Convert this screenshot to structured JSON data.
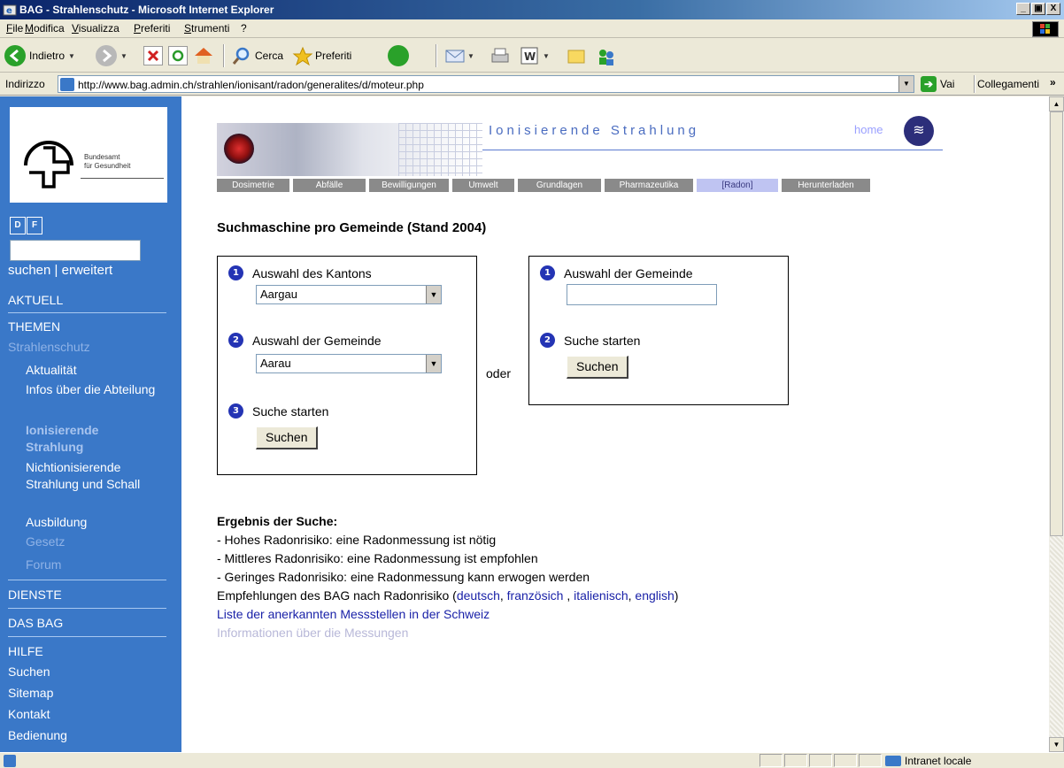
{
  "window": {
    "title": "BAG - Strahlenschutz - Microsoft Internet Explorer",
    "caption_buttons": [
      "_",
      " ",
      "X"
    ]
  },
  "menu": [
    "File",
    "Modifica",
    "Visualizza",
    "Preferiti",
    "Strumenti",
    "?"
  ],
  "toolbar": {
    "back_label": "Indietro",
    "search_label": "Cerca",
    "favorites_label": "Preferiti"
  },
  "address": {
    "label": "Indirizzo",
    "url": "http://www.bag.admin.ch/strahlen/ionisant/radon/generalites/d/moteur.php",
    "go_label": "Vai",
    "links_label": "Collegamenti"
  },
  "sidebar": {
    "logo_text_line1": "Bundesamt",
    "logo_text_line2": "für Gesundheit",
    "lang_d": "D",
    "lang_f": "F",
    "search_links": "suchen | erweitert",
    "items": [
      {
        "label": "AKTUELL"
      },
      {
        "label": "THEMEN"
      },
      {
        "label": "Strahlenschutz"
      },
      {
        "label": "Aktualität"
      },
      {
        "label": "Infos über die Abteilung"
      },
      {
        "label": "Ionisierende Strahlung"
      },
      {
        "label": "Nichtionisierende Strahlung und Schall"
      },
      {
        "label": "Ausbildung"
      },
      {
        "label": "Gesetz"
      },
      {
        "label": "Forum"
      },
      {
        "label": "DIENSTE"
      },
      {
        "label": "DAS BAG"
      },
      {
        "label": "HILFE"
      },
      {
        "label": "Suchen"
      },
      {
        "label": "Sitemap"
      },
      {
        "label": "Kontakt"
      },
      {
        "label": "Bedienung"
      }
    ]
  },
  "banner": {
    "title": "Ionisierende Strahlung",
    "home_label": "home"
  },
  "navtabs": [
    "Dosimetrie",
    "Abfälle",
    "Bewilligungen",
    "Umwelt",
    "Grundlagen",
    "Pharmazeutika",
    "[Radon]",
    "Herunterladen"
  ],
  "content": {
    "page_title": "Suchmaschine pro Gemeinde (Stand 2004)",
    "left_panel": {
      "step1_num": "1",
      "step1_label": "Auswahl des Kantons",
      "canton_value": "Aargau",
      "step2_num": "2",
      "step2_label": "Auswahl der Gemeinde",
      "gemeinde_value": "Aarau",
      "step3_num": "3",
      "step3_label": "Suche starten",
      "button_label": "Suchen"
    },
    "oder": "oder",
    "right_panel": {
      "step1_num": "1",
      "step1_label": "Auswahl der Gemeinde",
      "input_value": "",
      "step2_num": "2",
      "step2_label": "Suche starten",
      "button_label": "Suchen"
    },
    "results": {
      "heading": "Ergebnis der Suche:",
      "lines": [
        "- Hohes Radonrisiko: eine Radonmessung ist nötig",
        "- Mittleres Radonrisiko: eine Radonmessung ist empfohlen",
        "- Geringes Radonrisiko: eine Radonmessung kann erwogen werden"
      ],
      "recommend_prefix": "Empfehlungen des BAG nach Radonrisiko (",
      "link_de": "deutsch",
      "link_fr": "französich",
      "link_it": "italienisch",
      "link_en": "english",
      "sep1": ", ",
      "sep2": " , ",
      "sep3": ", ",
      "recommend_suffix": ")",
      "link_list": "Liste der anerkannten Messstellen in der Schweiz",
      "link_info": "Informationen über die Messungen"
    }
  },
  "status": {
    "zone": "Intranet locale"
  },
  "colors": {
    "sidebar_bg": "#3a78c8",
    "link": "#1a22a8",
    "step_number": "#2434b4",
    "active_tab": "#bfc4f2"
  }
}
